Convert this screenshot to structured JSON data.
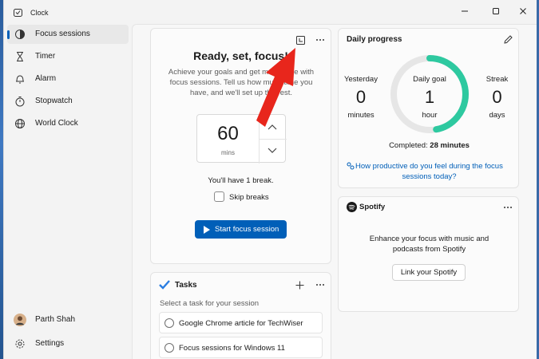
{
  "window": {
    "title": "Clock"
  },
  "sidebar": {
    "items": [
      {
        "label": "Focus sessions",
        "active": true
      },
      {
        "label": "Timer"
      },
      {
        "label": "Alarm"
      },
      {
        "label": "Stopwatch"
      },
      {
        "label": "World Clock"
      }
    ],
    "user": {
      "name": "Parth Shah"
    },
    "settings_label": "Settings"
  },
  "focus": {
    "title": "Ready, set, focus!",
    "description": "Achieve your goals and get more done with focus sessions. Tell us how much time you have, and we'll set up the rest.",
    "timer_value": "60",
    "timer_unit": "mins",
    "break_text": "You'll have 1 break.",
    "skip_breaks_label": "Skip breaks",
    "start_label": "Start focus session"
  },
  "tasks": {
    "title": "Tasks",
    "prompt": "Select a task for your session",
    "items": [
      {
        "label": "Google Chrome article for TechWiser"
      },
      {
        "label": "Focus sessions for Windows 11"
      }
    ]
  },
  "progress": {
    "title": "Daily progress",
    "yesterday": {
      "label": "Yesterday",
      "value": "0",
      "unit": "minutes"
    },
    "goal": {
      "label": "Daily goal",
      "value": "1",
      "unit": "hour"
    },
    "streak": {
      "label": "Streak",
      "value": "0",
      "unit": "days"
    },
    "completed_label": "Completed:",
    "completed_value": "28 minutes",
    "completion_fraction": 0.47,
    "feedback_link_line1": "How productive do you feel during the focus",
    "feedback_link_line2": "sessions today?"
  },
  "spotify": {
    "brand": "Spotify",
    "message_line1": "Enhance your focus with music and",
    "message_line2": "podcasts from Spotify",
    "link_label": "Link your Spotify"
  },
  "colors": {
    "accent": "#005fb8",
    "ring_progress": "#2ec9a0",
    "ring_track": "#e6e6e6",
    "annotation_arrow": "#e8261c"
  }
}
